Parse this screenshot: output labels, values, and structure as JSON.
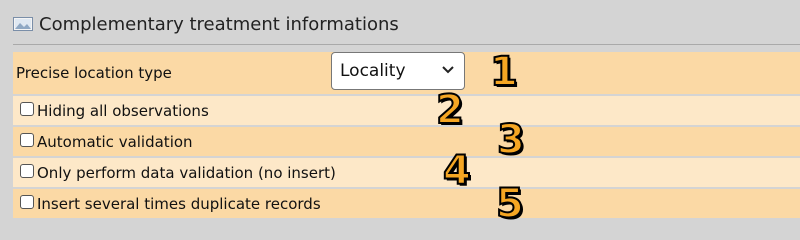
{
  "panel": {
    "title": "Complementary treatment informations",
    "icon": "image-icon"
  },
  "precise_location": {
    "label": "Precise location type",
    "selected": "Locality"
  },
  "options": [
    {
      "label": "Hiding all observations",
      "checked": false
    },
    {
      "label": "Automatic validation",
      "checked": false
    },
    {
      "label": "Only perform data validation (no insert)",
      "checked": false
    },
    {
      "label": "Insert several times duplicate records",
      "checked": false
    }
  ],
  "annotations": [
    "1",
    "2",
    "3",
    "4",
    "5"
  ],
  "colors": {
    "row_dark": "#fbd9a5",
    "row_light": "#fde8c8",
    "annotation_fill": "#f5a623",
    "background": "#d4d4d4"
  }
}
